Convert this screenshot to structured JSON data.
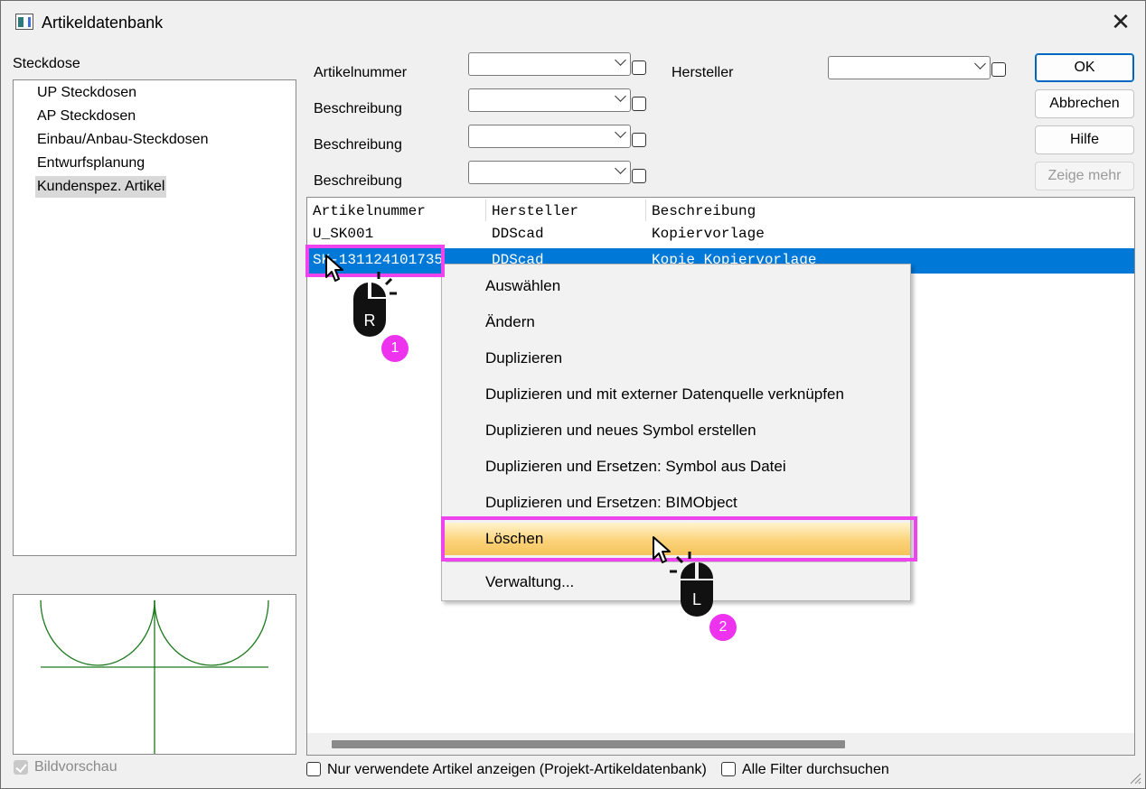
{
  "window": {
    "title": "Artikeldatenbank",
    "close_glyph": "✕"
  },
  "category": {
    "label": "Steckdose",
    "items": [
      {
        "label": "UP Steckdosen",
        "selected": false
      },
      {
        "label": "AP Steckdosen",
        "selected": false
      },
      {
        "label": "Einbau/Anbau-Steckdosen",
        "selected": false
      },
      {
        "label": "Entwurfsplanung",
        "selected": false
      },
      {
        "label": "Kundenspez. Artikel",
        "selected": true
      }
    ]
  },
  "filters": {
    "artikelnummer_label": "Artikelnummer",
    "beschreibung1_label": "Beschreibung",
    "beschreibung2_label": "Beschreibung",
    "beschreibung3_label": "Beschreibung",
    "hersteller_label": "Hersteller"
  },
  "buttons": {
    "ok": "OK",
    "cancel": "Abbrechen",
    "help": "Hilfe",
    "more": "Zeige mehr"
  },
  "table": {
    "columns": [
      "Artikelnummer",
      "Hersteller",
      "Beschreibung"
    ],
    "rows": [
      {
        "artikelnummer": "U_SK001",
        "hersteller": "DDScad",
        "beschreibung": "Kopiervorlage",
        "selected": false
      },
      {
        "artikelnummer": "SK-131124101735",
        "hersteller": "DDScad",
        "beschreibung": "Kopie Kopiervorlage",
        "selected": true
      }
    ]
  },
  "context_menu": {
    "items": [
      "Auswählen",
      "Ändern",
      "Duplizieren",
      "Duplizieren und mit externer Datenquelle verknüpfen",
      "Duplizieren und neues Symbol erstellen",
      "Duplizieren und Ersetzen: Symbol aus Datei",
      "Duplizieren und Ersetzen: BIMObject",
      "Löschen",
      "Verwaltung..."
    ],
    "highlighted": "Löschen"
  },
  "bottom": {
    "preview_label": "Bildvorschau",
    "preview_checked": true,
    "used_only_label": "Nur verwendete Artikel anzeigen (Projekt-Artikeldatenbank)",
    "all_filters_label": "Alle Filter durchsuchen"
  },
  "annotations": {
    "step1": "1",
    "step2": "2",
    "right_mouse_letter": "R",
    "left_mouse_letter": "L",
    "highlight_color": "#ee44ee"
  }
}
